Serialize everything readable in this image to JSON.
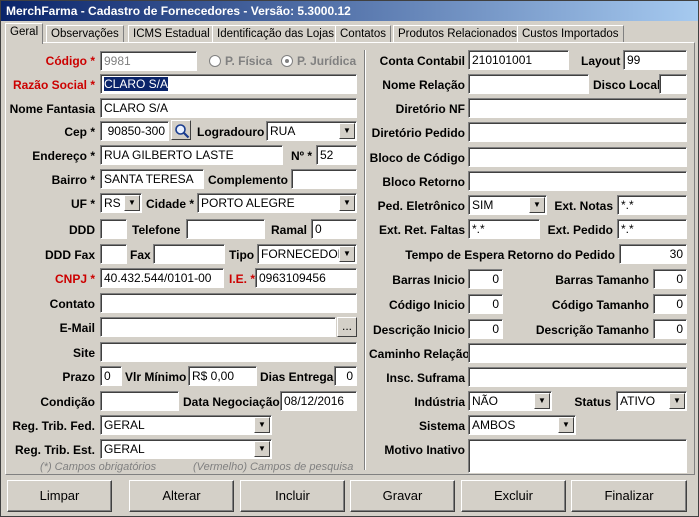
{
  "window": {
    "title": "MerchFarma - Cadastro de Fornecedores - Versão: 5.3000.12"
  },
  "tabs": [
    {
      "label": "Geral",
      "active": true
    },
    {
      "label": "Observações"
    },
    {
      "label": "ICMS Estadual"
    },
    {
      "label": "Identificação das Lojas"
    },
    {
      "label": "Contatos"
    },
    {
      "label": "Produtos Relacionados"
    },
    {
      "label": "Custos Importados"
    }
  ],
  "left": {
    "codigo": {
      "label": "Código *",
      "value": "9981"
    },
    "pessoa": {
      "fisica": "P. Física",
      "juridica": "P. Jurídica"
    },
    "razao_social": {
      "label": "Razão Social *",
      "value": "CLARO S/A"
    },
    "nome_fantasia": {
      "label": "Nome Fantasia",
      "value": "CLARO S/A"
    },
    "cep": {
      "label": "Cep *",
      "value": "90850-300"
    },
    "logradouro": {
      "label": "Logradouro",
      "value": "RUA"
    },
    "endereco": {
      "label": "Endereço *",
      "value": "RUA GILBERTO LASTE"
    },
    "numero": {
      "label": "Nº *",
      "value": "52"
    },
    "bairro": {
      "label": "Bairro *",
      "value": "SANTA TERESA"
    },
    "complemento": {
      "label": "Complemento",
      "value": ""
    },
    "uf": {
      "label": "UF *",
      "value": "RS"
    },
    "cidade": {
      "label": "Cidade *",
      "value": "PORTO ALEGRE"
    },
    "ddd": {
      "label": "DDD",
      "value": ""
    },
    "telefone": {
      "label": "Telefone",
      "value": ""
    },
    "ramal": {
      "label": "Ramal",
      "value": "0"
    },
    "ddd_fax": {
      "label": "DDD Fax",
      "value": ""
    },
    "fax": {
      "label": "Fax",
      "value": ""
    },
    "tipo": {
      "label": "Tipo",
      "value": "FORNECEDOR"
    },
    "cnpj": {
      "label": "CNPJ *",
      "value": "40.432.544/0101-00"
    },
    "ie": {
      "label": "I.E. *",
      "value": "0963109456"
    },
    "contato": {
      "label": "Contato",
      "value": ""
    },
    "email": {
      "label": "E-Mail",
      "value": "",
      "button": "..."
    },
    "site": {
      "label": "Site",
      "value": ""
    },
    "prazo": {
      "label": "Prazo",
      "value": "0"
    },
    "vlr_minimo": {
      "label": "Vlr Mínimo",
      "value": "R$ 0,00"
    },
    "dias_entrega": {
      "label": "Dias Entrega",
      "value": "0"
    },
    "condicao": {
      "label": "Condição",
      "value": ""
    },
    "data_negociacao": {
      "label": "Data Negociação *",
      "value": "08/12/2016"
    },
    "reg_trib_fed": {
      "label": "Reg. Trib. Fed.",
      "value": "GERAL"
    },
    "reg_trib_est": {
      "label": "Reg. Trib. Est.",
      "value": "GERAL"
    },
    "note_required": "(*) Campos obrigatórios",
    "note_search": "(Vermelho) Campos  de pesquisa"
  },
  "right": {
    "conta_contabil": {
      "label": "Conta Contabil",
      "value": "210101001"
    },
    "layout": {
      "label": "Layout",
      "value": "99"
    },
    "nome_relacao": {
      "label": "Nome Relação",
      "value": ""
    },
    "disco_local": {
      "label": "Disco Local",
      "value": ""
    },
    "diretorio_nf": {
      "label": "Diretório NF",
      "value": ""
    },
    "diretorio_pedido": {
      "label": "Diretório Pedido",
      "value": ""
    },
    "bloco_codigo": {
      "label": "Bloco de Código",
      "value": ""
    },
    "bloco_retorno": {
      "label": "Bloco Retorno",
      "value": ""
    },
    "ped_eletronico": {
      "label": "Ped. Eletrônico",
      "value": "SIM"
    },
    "ext_notas": {
      "label": "Ext. Notas",
      "value": "*.*"
    },
    "ext_ret_faltas": {
      "label": "Ext. Ret. Faltas",
      "value": "*.*"
    },
    "ext_pedido": {
      "label": "Ext. Pedido",
      "value": "*.*"
    },
    "tempo_espera": {
      "label": "Tempo de Espera Retorno do Pedido",
      "value": "30"
    },
    "barras_inicio": {
      "label": "Barras Inicio",
      "value": "0"
    },
    "barras_tamanho": {
      "label": "Barras Tamanho",
      "value": "0"
    },
    "codigo_inicio": {
      "label": "Código Inicio",
      "value": "0"
    },
    "codigo_tamanho": {
      "label": "Código Tamanho",
      "value": "0"
    },
    "descricao_inicio": {
      "label": "Descrição Inicio",
      "value": "0"
    },
    "descricao_tamanho": {
      "label": "Descrição Tamanho",
      "value": "0"
    },
    "caminho_relacao": {
      "label": "Caminho Relação",
      "value": ""
    },
    "insc_suframa": {
      "label": "Insc. Suframa",
      "value": ""
    },
    "industria": {
      "label": "Indústria",
      "value": "NÃO"
    },
    "status": {
      "label": "Status",
      "value": "ATIVO"
    },
    "sistema": {
      "label": "Sistema",
      "value": "AMBOS"
    },
    "motivo_inativo": {
      "label": "Motivo Inativo",
      "value": ""
    }
  },
  "buttons": {
    "limpar": "Limpar",
    "alterar": "Alterar",
    "incluir": "Incluir",
    "gravar": "Gravar",
    "excluir": "Excluir",
    "finalizar": "Finalizar"
  },
  "colors": {
    "title_start": "#0a246a",
    "title_end": "#a6caf0",
    "required": "#cc0000",
    "face": "#d4d0c8"
  },
  "icons": {
    "search": "magnifier-icon",
    "dropdown": "chevron-down-icon"
  }
}
